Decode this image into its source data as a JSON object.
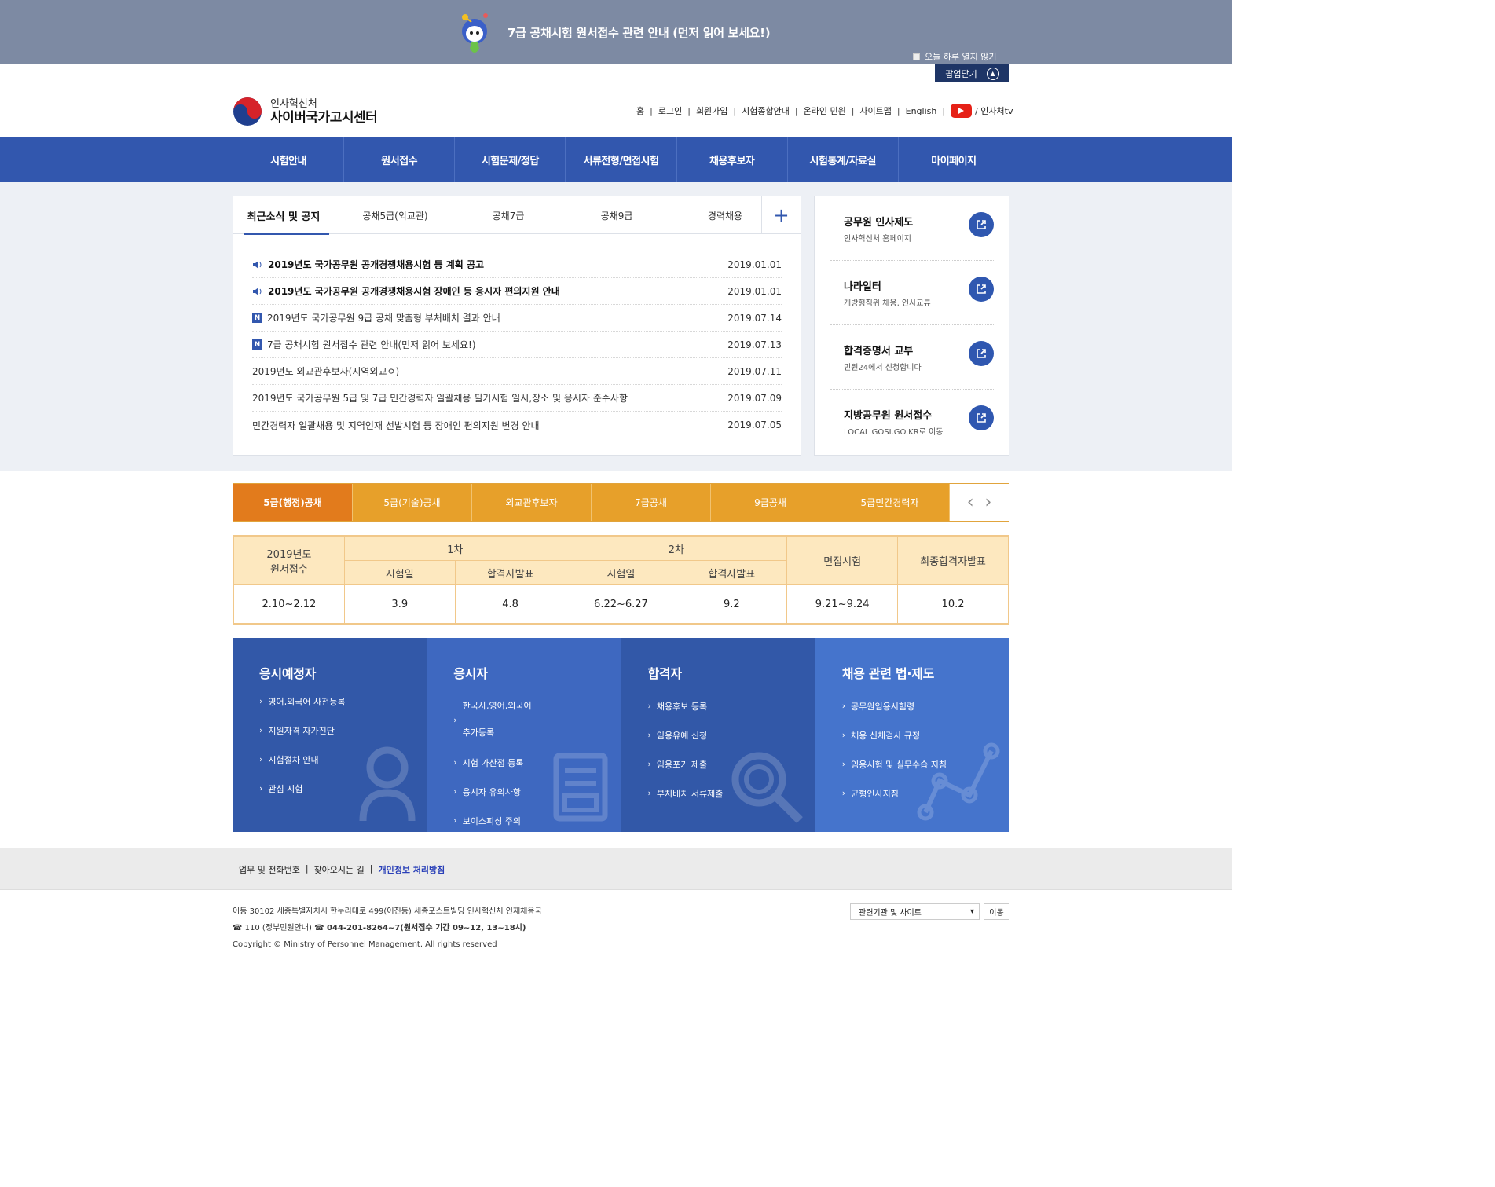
{
  "popup": {
    "title": "7급 공채시험 원서접수 관련 안내 (먼저 읽어 보세요!)",
    "no_display_today": "오늘 하루 열지 않기",
    "close_label": "팝업닫기"
  },
  "header": {
    "logo_sub": "인사혁신처",
    "logo_main": "사이버국가고시센터",
    "util_links": [
      "홈",
      "로그인",
      "회원가입",
      "시험종합안내",
      "온라인 민원",
      "사이트맵",
      "English"
    ],
    "tv_label": "/ 인사처tv"
  },
  "gnb": [
    "시험안내",
    "원서접수",
    "시험문제/정답",
    "서류전형/면접시험",
    "채용후보자",
    "시험통계/자료실",
    "마이페이지"
  ],
  "notice": {
    "tabs": [
      "최근소식 및 공지",
      "공채5급(외교관)",
      "공채7급",
      "공채9급",
      "경력채용"
    ],
    "more": "+",
    "items": [
      {
        "title": "2019년도 국가공무원 공개경쟁채용시험 등 계획 공고",
        "date": "2019.01.01"
      },
      {
        "title": "2019년도 국가공무원 공개경쟁채용시험 장애인 등 응시자 편의지원 안내",
        "date": "2019.01.01"
      },
      {
        "title": "2019년도 국가공무원 9급 공채 맞춤형 부처배치 결과 안내",
        "date": "2019.07.14"
      },
      {
        "title": "7급 공채시험 원서접수 관련 안내(먼저 읽어 보세요!)",
        "date": "2019.07.13"
      },
      {
        "title": "2019년도 외교관후보자(지역외교ㅇ)",
        "date": "2019.07.11"
      },
      {
        "title": "2019년도 국가공무원 5급 및 7급 민간경력자 일괄채용 필기시험 일시,장소 및 응시자 준수사항",
        "date": "2019.07.09"
      },
      {
        "title": "민간경력자 일괄채용 및 지역인재 선발시험 등 장애인 편의지원 변경 안내",
        "date": "2019.07.05"
      }
    ],
    "badge": "N"
  },
  "quick": [
    {
      "title": "공무원 인사제도",
      "sub": "인사혁신처 홈페이지"
    },
    {
      "title": "나라일터",
      "sub": "개방형직위 채용, 인사교류"
    },
    {
      "title": "합격증명서 교부",
      "sub": "민원24에서 신청합니다"
    },
    {
      "title": "지방공무원 원서접수",
      "sub": "LOCAL GOSI.GO.KR로 이동"
    }
  ],
  "schedule": {
    "tabs": [
      "5급(행정)공채",
      "5급(기술)공채",
      "외교관후보자",
      "7급공채",
      "9급공채",
      "5급민간경력자"
    ],
    "prev": "‹",
    "next": "›",
    "head_year": "2019년도",
    "head_apply": "원서접수",
    "round1": "1차",
    "round2": "2차",
    "exam_date": "시험일",
    "pass_announce": "합격자발표",
    "interview": "면접시험",
    "final": "최종합격자발표",
    "values": [
      "2.10~2.12",
      "3.9",
      "4.8",
      "6.22~6.27",
      "9.2",
      "9.21~9.24",
      "10.2"
    ]
  },
  "boxes": [
    {
      "title": "응시예정자",
      "color": "#3258a8",
      "items": [
        "영어,외국어 사전등록",
        "지원자격 자가진단",
        "시험절차 안내",
        "관심 시험"
      ]
    },
    {
      "title": "응시자",
      "color": "#3e68c0",
      "items": [
        "한국사,영어,외국어",
        "추가등록",
        "시험 가산점 등록",
        "응시자 유의사항",
        "보이스피싱 주의"
      ]
    },
    {
      "title": "합격자",
      "color": "#3258a8",
      "items": [
        "채용후보 등록",
        "임용유예 신청",
        "임용포기 제출",
        "부처배치 서류제출"
      ]
    },
    {
      "title": "채용 관련 법·제도",
      "color": "#4574cc",
      "items": [
        "공무원임용시험령",
        "채용 신체검사 규정",
        "임용시험 및 실무수습 지침",
        "균형인사지침"
      ]
    }
  ],
  "footer": {
    "links": [
      "업무 및 전화번호",
      "찾아오시는 길",
      "개인정보 처리방침"
    ],
    "address": "이동 30102 세종특별자치시 한누리대로 499(어진동) 세종포스트빌딩 인사혁신처 인재채용국",
    "phone1": "☎ 110 (정부민원안내)",
    "phone2": "☎ 044-201-8264~7(원서접수 기간 09~12, 13~18시)",
    "copyright": "Copyright © Ministry of Personnel Management. All rights reserved",
    "select_label": "관련기관 및 사이트",
    "go_label": "이동"
  }
}
